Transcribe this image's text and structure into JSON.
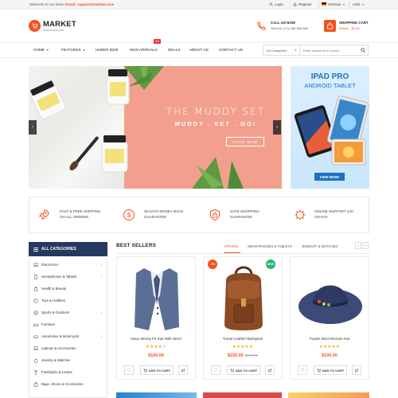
{
  "topbar": {
    "welcome": "Welcome to our store!",
    "email_label": "Email: support@market.com",
    "login": "Login",
    "register": "Register",
    "language": "German",
    "currency": "USD"
  },
  "header": {
    "logo_title": "MARKET",
    "logo_tagline": "Shop all you need",
    "call_title": "CALL US NOW",
    "call_number": "Toll free: (+1) 268 368 668",
    "cart_title": "SHOPPING CART",
    "cart_items": "02item - $0.00"
  },
  "nav": {
    "items": [
      "HOME",
      "FEATURES",
      "UNDER $100",
      "NEW ARRIVALS",
      "DEALS",
      "ABOUT US",
      "CONTACT US"
    ],
    "hot_badge": "Hot"
  },
  "search": {
    "category": "All Categories",
    "placeholder": "Enter keywords to search..."
  },
  "hero": {
    "title": "THE MUDDY SET",
    "subtitle": "MUDDY . SET . GO!",
    "button": "SHOP NOW"
  },
  "side_banner": {
    "title": "IPAD PRO",
    "subtitle": "ANDROID TABLET",
    "button": "VIEW MORE"
  },
  "features": [
    {
      "icon": "rocket-icon",
      "line1": "FAST & FREE SHIPPING",
      "line2": "ON ALL ORDERS"
    },
    {
      "icon": "money-icon",
      "line1": "30 DAYS MONEY BACK",
      "line2": "GUARANTEE"
    },
    {
      "icon": "shield-lock-icon",
      "line1": "SAFE SHOPPING",
      "line2": "GUARANTEE"
    },
    {
      "icon": "support-icon",
      "line1": "ONLINE SUPPORT 24H",
      "line2": "ON DAY"
    }
  ],
  "categories": {
    "title": "ALL CATEGORIES",
    "items": [
      {
        "label": "Electronics",
        "icon": "laptop-icon",
        "has_sub": true
      },
      {
        "label": "Smartphones & Tablets",
        "icon": "phone-icon",
        "has_sub": true
      },
      {
        "label": "Health & Beauty",
        "icon": "bottle-icon",
        "has_sub": false
      },
      {
        "label": "Toys & Hobbies",
        "icon": "toy-icon",
        "has_sub": false
      },
      {
        "label": "Sports & Outdoors",
        "icon": "ball-icon",
        "has_sub": true
      },
      {
        "label": "Furniture",
        "icon": "sofa-icon",
        "has_sub": false
      },
      {
        "label": "Automotive & Motorcycle",
        "icon": "car-icon",
        "has_sub": true
      },
      {
        "label": "Laptops & Accessories",
        "icon": "laptop-icon",
        "has_sub": false
      },
      {
        "label": "Jewelry & Watches",
        "icon": "ring-icon",
        "has_sub": false
      },
      {
        "label": "Flashlights & Lamps",
        "icon": "lamp-icon",
        "has_sub": false
      },
      {
        "label": "Bags, Shoes & Accessories",
        "icon": "bag-icon",
        "has_sub": false
      }
    ]
  },
  "best_sellers": {
    "title": "BEST SELLERS",
    "tabs": [
      "APPAREL",
      "SMARTPHONES & TABLETS",
      "JEWELRY & WATCHES"
    ],
    "active_tab": 0,
    "add_to_cart": "ADD TO CART",
    "products": [
      {
        "name": "Navy Skinny Fit Suit With Wool",
        "rating": 4,
        "price": "$100.00",
        "old_price": "",
        "badge": ""
      },
      {
        "name": "Travel Leather Backpack",
        "rating": 5,
        "price": "$220.00",
        "old_price": "$229.00",
        "badge": "-5%"
      },
      {
        "name": "Purple Wool Women Hat",
        "rating": 5,
        "price": "$105.00",
        "old_price": "",
        "badge": "NEW"
      }
    ]
  },
  "colors": {
    "accent": "#f4511e",
    "navy": "#253961",
    "star": "#f4b400",
    "badge_sale": "#f4511e",
    "badge_new": "#2bb673",
    "ipad_blue": "#1d71c2"
  }
}
